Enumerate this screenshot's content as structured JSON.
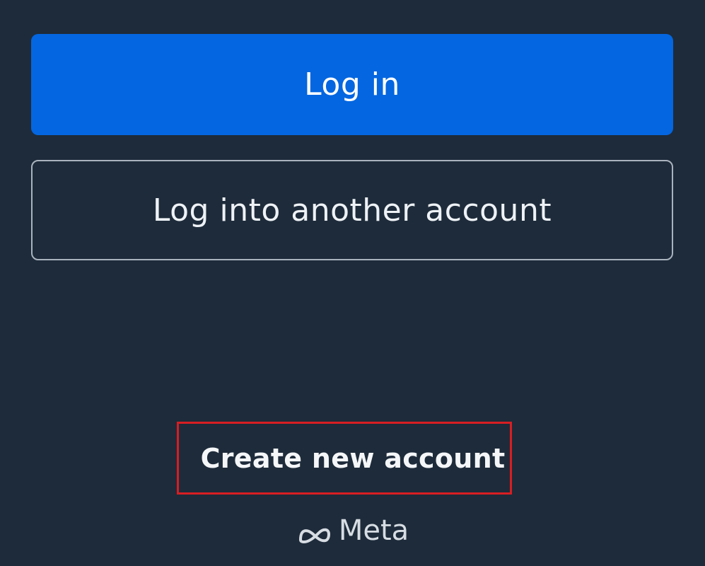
{
  "actions": {
    "login_label": "Log in",
    "other_account_label": "Log into another account",
    "create_account_label": "Create new account"
  },
  "footer": {
    "brand": "Meta",
    "brand_icon": "meta-infinity-icon"
  },
  "colors": {
    "background": "#1e2b3a",
    "primary": "#0466e0",
    "highlight_border": "#d81e22"
  }
}
